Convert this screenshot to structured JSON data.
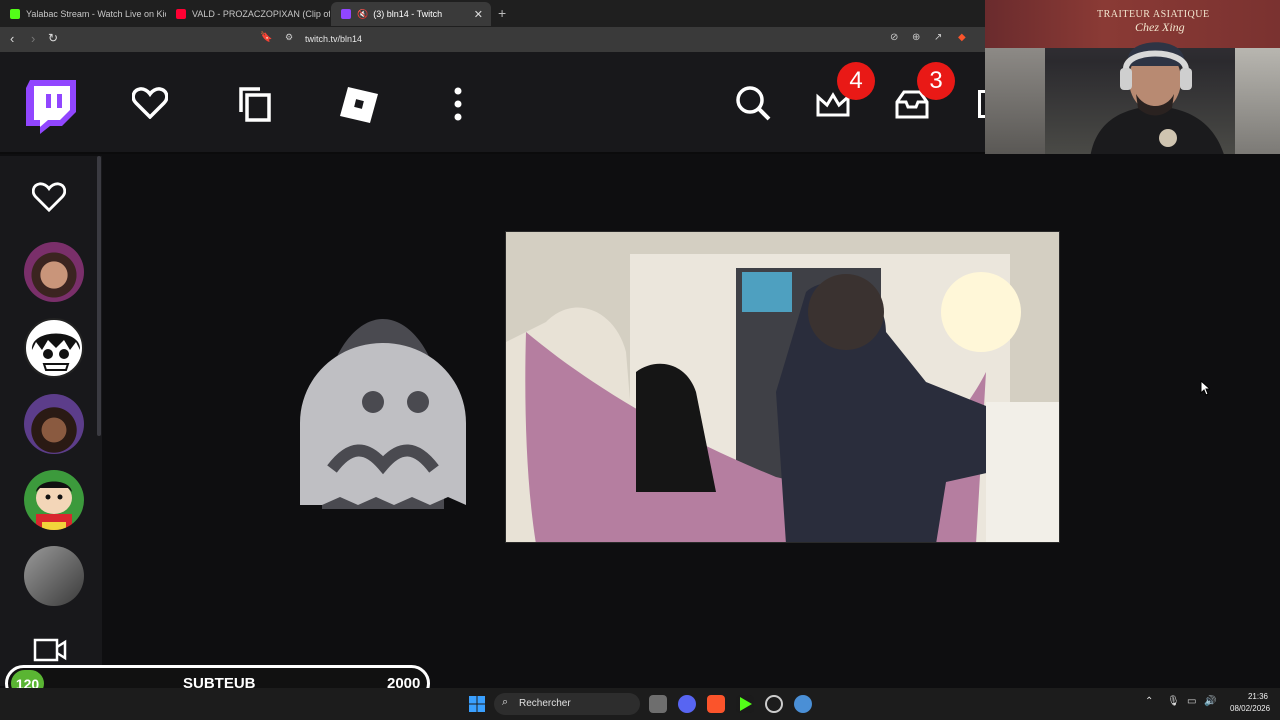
{
  "browser": {
    "tabs": [
      {
        "label": "Yalabac Stream - Watch Live on Kick",
        "favicon_color": "#53fc18"
      },
      {
        "label": "VALD - PROZACZOPIXAN (Clip offici",
        "favicon_color": "#ff0033"
      },
      {
        "label": "(3) bln14 - Twitch",
        "favicon_color": "#9146ff",
        "active": true
      }
    ],
    "new_tab_label": "+",
    "url": "twitch.tv/bln14"
  },
  "twitch_nav": {
    "notifications_badge": "4",
    "inbox_badge": "3",
    "brand_color": "#9146ff",
    "icons": [
      "twitch-logo-icon",
      "heart-icon",
      "copy-icon",
      "roblox-icon",
      "more-vertical-icon",
      "search-icon",
      "crown-icon",
      "inbox-icon"
    ]
  },
  "webcam": {
    "store_sign_line1": "TRAITEUR ASIATIQUE",
    "store_sign_line2": "Chez Xing"
  },
  "sidebar": {
    "followed_icon": "heart-icon",
    "channels": [
      {
        "avatar_color": "#7a2f6a"
      },
      {
        "avatar_color": "#ffffff"
      },
      {
        "avatar_color": "#5c3d8a"
      },
      {
        "avatar_color": "#3c9a3c"
      },
      {
        "avatar_color": "#6d6d6d"
      }
    ],
    "bottom_icon": "video-camera-icon"
  },
  "sub_goal": {
    "current": "120",
    "label": "SUBTEUB",
    "target": "2000"
  },
  "taskbar": {
    "search_placeholder": "Rechercher",
    "time": "21:36",
    "date": "08/02/2026"
  }
}
